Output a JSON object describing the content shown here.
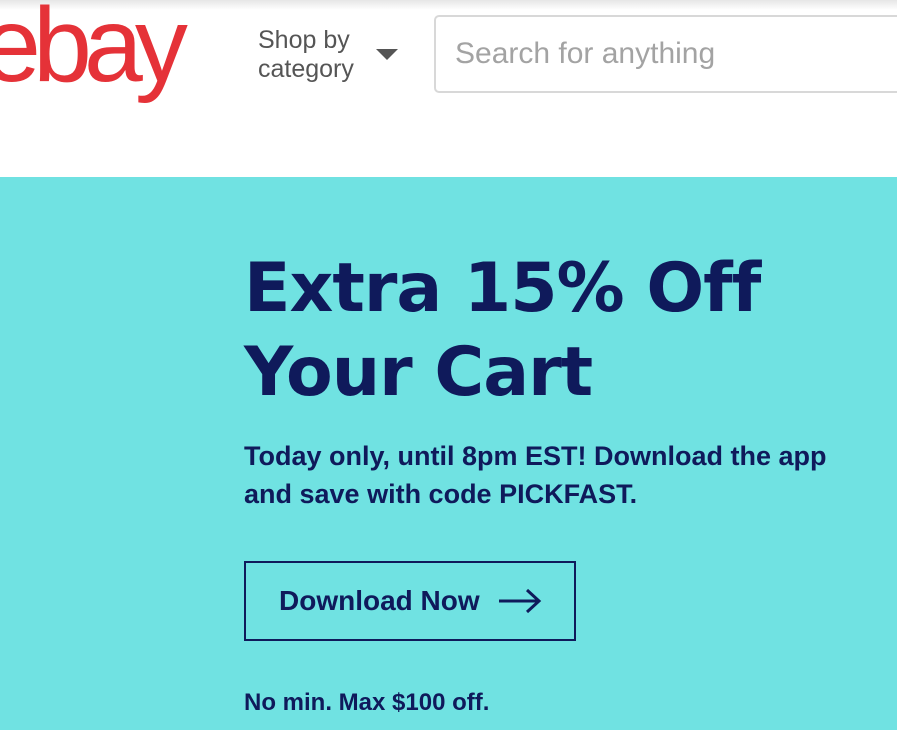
{
  "header": {
    "logo_text": "ebay",
    "shop_by_category_label": "Shop by category",
    "search_placeholder": "Search for anything"
  },
  "promo": {
    "headline_line1": "Extra 15% Off",
    "headline_line2": "Your Cart",
    "subtext_line1": "Today only, until 8pm EST! Download the app",
    "subtext_line2": "and save with code PICKFAST.",
    "cta_label": "Download Now",
    "fine_print": "No min. Max $100 off."
  },
  "colors": {
    "brand_red": "#e53238",
    "promo_bg": "#70e2e2",
    "navy_text": "#0f1a5b"
  },
  "icons": {
    "caret": "chevron-down-icon",
    "cta_arrow": "arrow-right-icon"
  }
}
